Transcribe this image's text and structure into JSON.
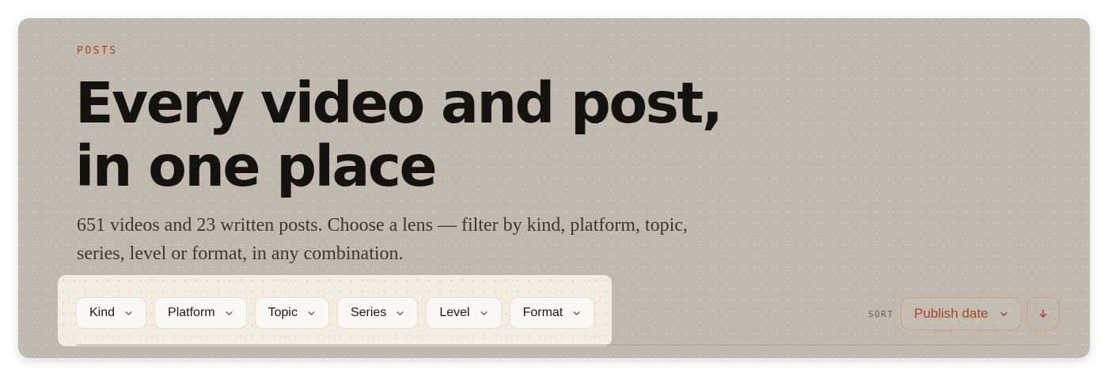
{
  "header": {
    "eyebrow": "POSTS",
    "title": "Every video and post, in one place",
    "subtitle": "651 videos and 23 written posts. Choose a lens — filter by kind, platform, topic, series, level or format, in any combination."
  },
  "filters": [
    {
      "label": "Kind",
      "icon": "chevron-down-icon"
    },
    {
      "label": "Platform",
      "icon": "chevron-down-icon"
    },
    {
      "label": "Topic",
      "icon": "chevron-down-icon"
    },
    {
      "label": "Series",
      "icon": "chevron-down-icon"
    },
    {
      "label": "Level",
      "icon": "chevron-down-icon"
    },
    {
      "label": "Format",
      "icon": "chevron-down-icon"
    }
  ],
  "sort": {
    "label": "SORT",
    "selected": "Publish date",
    "direction_icon": "arrow-down-icon"
  },
  "colors": {
    "accent": "#a8452a",
    "card_background": "#c1b9ad",
    "highlight_background": "#f3ece0",
    "title": "#15130f"
  }
}
